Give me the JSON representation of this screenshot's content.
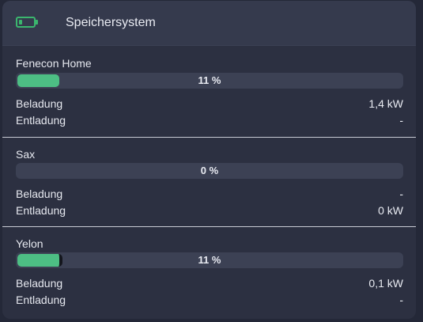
{
  "card": {
    "title": "Speichersystem",
    "icon": "battery-icon",
    "accent": "#3bb66e"
  },
  "systems": [
    {
      "name": "Fenecon Home",
      "level_percent": 11,
      "level_label": "11 %",
      "charge_label": "Beladung",
      "charge_value": "1,4 kW",
      "discharge_label": "Entladung",
      "discharge_value": "-"
    },
    {
      "name": "Sax",
      "level_percent": 0,
      "level_label": "0 %",
      "charge_label": "Beladung",
      "charge_value": "-",
      "discharge_label": "Entladung",
      "discharge_value": "0 kW"
    },
    {
      "name": "Yelon",
      "level_percent": 11,
      "level_label": "11 %",
      "charge_label": "Beladung",
      "charge_value": "0,1 kW",
      "discharge_label": "Entladung",
      "discharge_value": "-"
    }
  ],
  "colors": {
    "bar_fill": "#4dbe84",
    "bar_track": "#3c4154",
    "card_bg": "#2c3041",
    "header_bg": "#353a4d"
  }
}
